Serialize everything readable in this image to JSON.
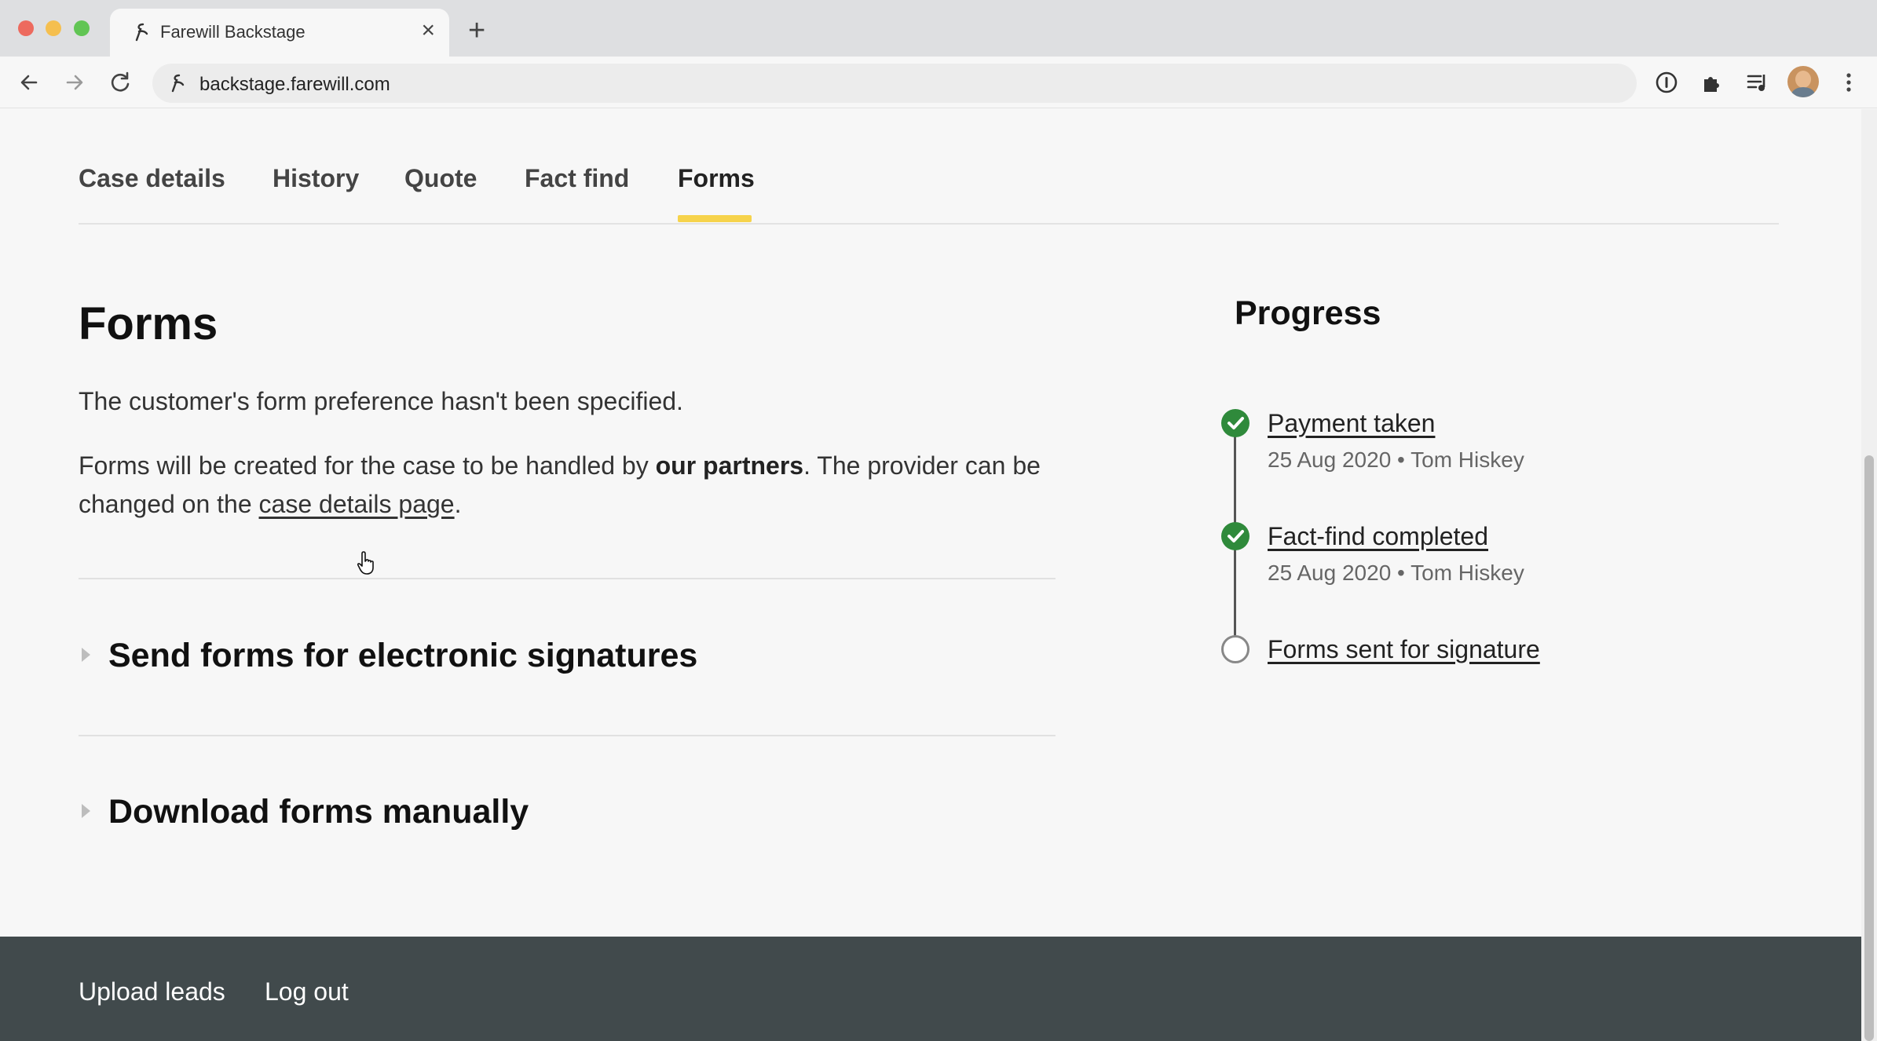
{
  "browser": {
    "tab_title": "Farewill Backstage",
    "url": "backstage.farewill.com"
  },
  "nav_tabs": [
    {
      "label": "Case details"
    },
    {
      "label": "History"
    },
    {
      "label": "Quote"
    },
    {
      "label": "Fact find"
    },
    {
      "label": "Forms",
      "active": true
    }
  ],
  "main": {
    "title": "Forms",
    "pref_text": "The customer's form preference hasn't been specified.",
    "partners_pre": "Forms will be created for the case to be handled by ",
    "partners_bold": "our partners",
    "partners_mid": ". The provider can be changed on the ",
    "partners_link": "case details page",
    "partners_end": ".",
    "sections": [
      {
        "label": "Send forms for electronic signatures"
      },
      {
        "label": "Download forms manually"
      }
    ]
  },
  "progress": {
    "title": "Progress",
    "steps": [
      {
        "label": "Payment taken",
        "meta": "25 Aug 2020 • Tom Hiskey",
        "done": true
      },
      {
        "label": "Fact-find completed",
        "meta": "25 Aug 2020 • Tom Hiskey",
        "done": true
      },
      {
        "label": "Forms sent for signature",
        "done": false
      }
    ]
  },
  "footer": {
    "links": [
      {
        "label": "Upload leads"
      },
      {
        "label": "Log out"
      }
    ]
  },
  "colors": {
    "accent_underline": "#f6d34b",
    "done_green": "#2f8a3b",
    "footer_bg": "#414a4c"
  }
}
